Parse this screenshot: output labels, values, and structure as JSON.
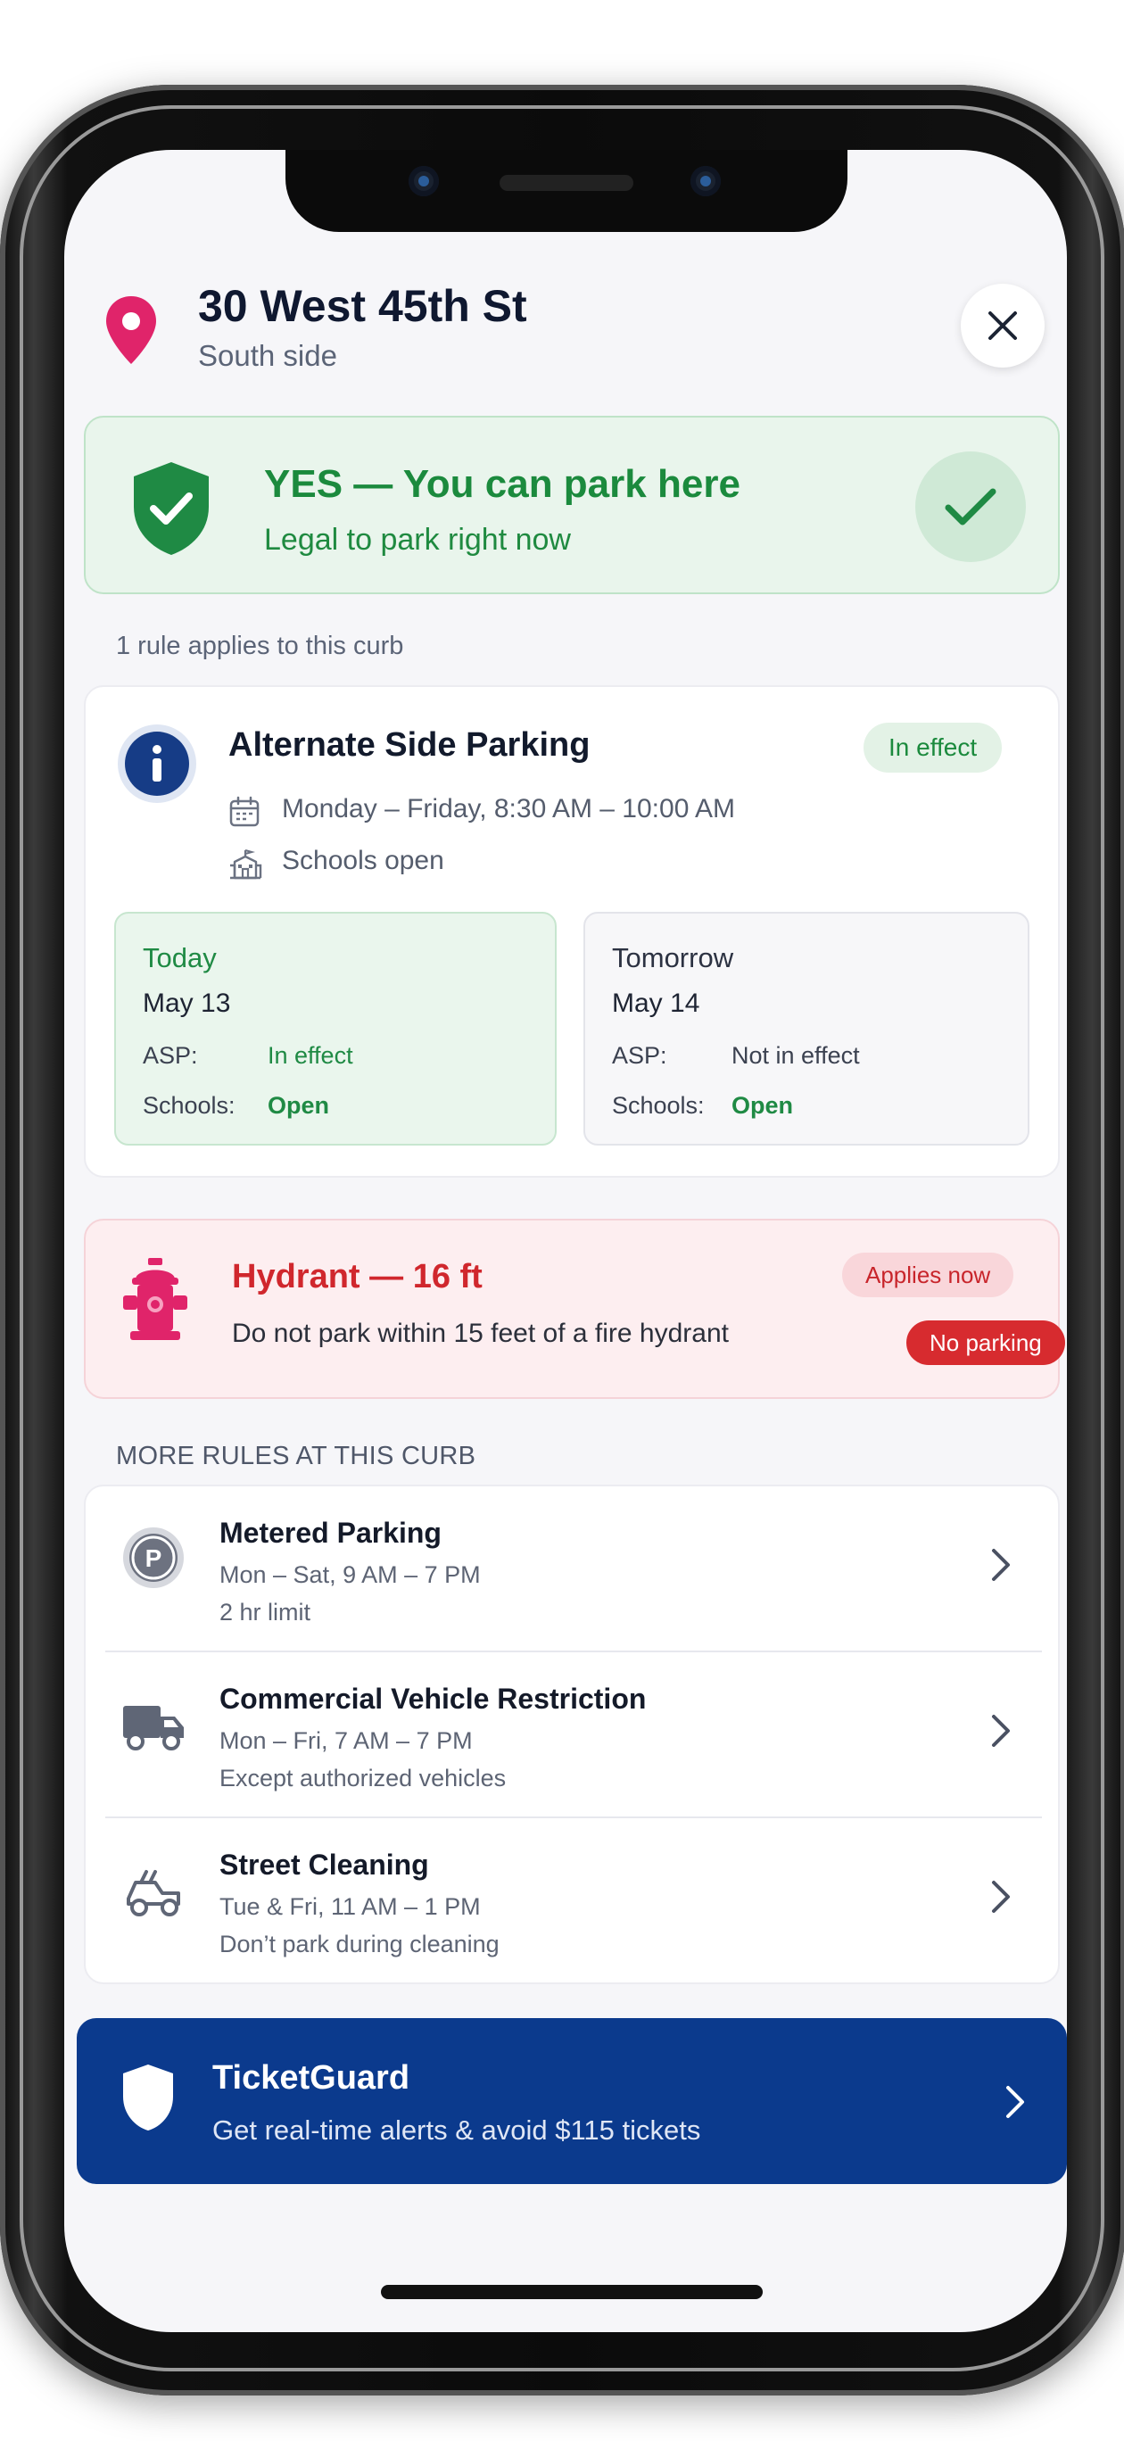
{
  "location": {
    "title": "30 West 45th St",
    "subtitle": "South side",
    "icon": "map-pin-icon"
  },
  "status": {
    "title": "YES — You can park here",
    "subtitle": "Legal to park right now",
    "color": "#1b8a3d"
  },
  "rule_count_text": "1 rule applies to this curb",
  "asp": {
    "title": "Alternate Side Parking",
    "badge": "In effect",
    "schedule": "Monday – Friday, 8:30 AM – 10:00 AM",
    "schools": "Schools open",
    "days": [
      {
        "label": "Today",
        "date": "May 13",
        "asp_label": "ASP:",
        "asp_value": "In effect",
        "schools_label": "Schools:",
        "schools_value": "Open"
      },
      {
        "label": "Tomorrow",
        "date": "May 14",
        "asp_label": "ASP:",
        "asp_value": "Not in effect",
        "schools_label": "Schools:",
        "schools_value": "Open"
      }
    ]
  },
  "hydrant": {
    "title": "Hydrant — 16 ft",
    "description": "Do not park within 15 feet of a fire hydrant",
    "badge_applies": "Applies now",
    "badge_no_parking": "No parking",
    "color": "#d0272d"
  },
  "more_rules": {
    "heading": "MORE RULES AT THIS CURB",
    "items": [
      {
        "title": "Metered Parking",
        "line1": "Mon – Sat, 9 AM – 7 PM",
        "line2": "2 hr limit",
        "icon": "parking-meter-icon"
      },
      {
        "title": "Commercial Vehicle Restriction",
        "line1": "Mon – Fri, 7 AM – 7 PM",
        "line2": "Except authorized vehicles",
        "icon": "truck-icon"
      },
      {
        "title": "Street Cleaning",
        "line1": "Tue & Fri, 11 AM – 1 PM",
        "line2": "Don’t park during cleaning",
        "icon": "street-sweeper-icon"
      }
    ]
  },
  "promo": {
    "title": "TicketGuard",
    "subtitle": "Get real-time alerts & avoid $115 tickets",
    "color": "#0b3a8d"
  }
}
